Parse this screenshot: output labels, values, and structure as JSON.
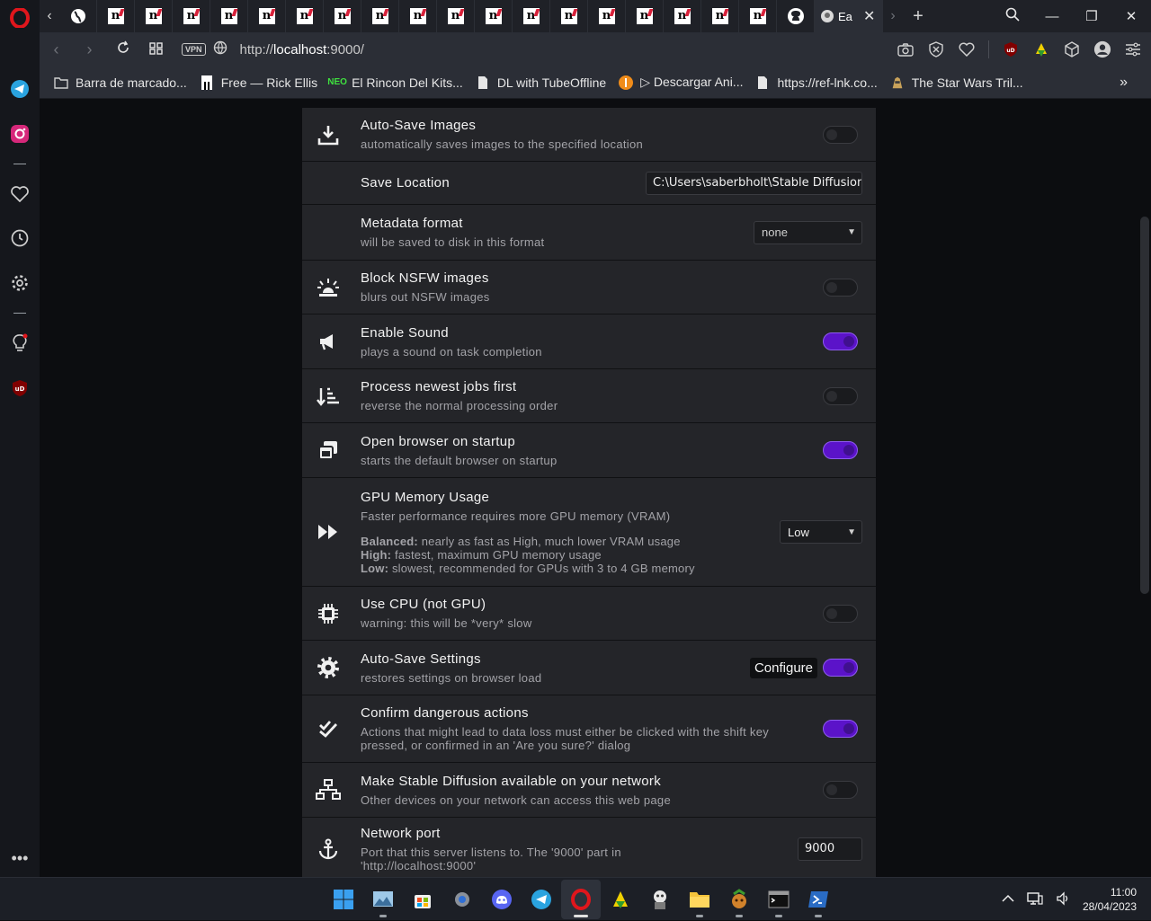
{
  "browser": {
    "active_tab_title": "Ea",
    "tab_letter": "n",
    "url_prefix": "http://",
    "url_host": "localhost",
    "url_rest": ":9000/",
    "vpn_label": "VPN"
  },
  "bookmarks": [
    {
      "label": "Barra de marcado...",
      "icon": "folder-icon"
    },
    {
      "label": "Free — Rick Ellis",
      "icon": "bookmark-favicon"
    },
    {
      "label": "El Rincon Del Kits...",
      "icon": "neo-favicon"
    },
    {
      "label": "DL with TubeOffline",
      "icon": "page-icon"
    },
    {
      "label": "▷ Descargar Ani...",
      "icon": "orange-favicon"
    },
    {
      "label": "https://ref-lnk.co...",
      "icon": "page-icon"
    },
    {
      "label": "The Star Wars Tril...",
      "icon": "starwars-favicon"
    }
  ],
  "settings": {
    "auto_save_images": {
      "title": "Auto-Save Images",
      "desc": "automatically saves images to the specified location",
      "on": false
    },
    "save_location": {
      "title": "Save Location",
      "value": "C:\\Users\\saberbholt\\Stable Diffusion UI"
    },
    "metadata_format": {
      "title": "Metadata format",
      "desc": "will be saved to disk in this format",
      "value": "none"
    },
    "block_nsfw": {
      "title": "Block NSFW images",
      "desc": "blurs out NSFW images",
      "on": false
    },
    "enable_sound": {
      "title": "Enable Sound",
      "desc": "plays a sound on task completion",
      "on": true
    },
    "process_newest": {
      "title": "Process newest jobs first",
      "desc": "reverse the normal processing order",
      "on": false
    },
    "open_browser": {
      "title": "Open browser on startup",
      "desc": "starts the default browser on startup",
      "on": true
    },
    "gpu_memory": {
      "title": "GPU Memory Usage",
      "desc": "Faster performance requires more GPU memory (VRAM)",
      "balanced_label": "Balanced:",
      "balanced_text": "nearly as fast as High, much lower VRAM usage",
      "high_label": "High:",
      "high_text": "fastest, maximum GPU memory usage",
      "low_label": "Low:",
      "low_text": "slowest, recommended for GPUs with 3 to 4 GB memory",
      "value": "Low"
    },
    "use_cpu": {
      "title": "Use CPU (not GPU)",
      "desc": "warning: this will be *very* slow",
      "on": false
    },
    "auto_save_settings": {
      "title": "Auto-Save Settings",
      "desc": "restores settings on browser load",
      "button": "Configure",
      "on": true
    },
    "confirm_dangerous": {
      "title": "Confirm dangerous actions",
      "desc": "Actions that might lead to data loss must either be clicked with the shift key pressed, or confirmed in an 'Are you sure?' dialog",
      "on": true
    },
    "network_available": {
      "title": "Make Stable Diffusion available on your network",
      "desc": "Other devices on your network can access this web page",
      "on": false
    },
    "network_port": {
      "title": "Network port",
      "desc": "Port that this server listens to. The '9000' part in 'http://localhost:9000'",
      "value": "9000"
    }
  },
  "taskbar": {
    "time": "11:00",
    "date": "28/04/2023"
  },
  "colors": {
    "toggle_on": "#5b13c9",
    "opera_red": "#e0161c"
  }
}
